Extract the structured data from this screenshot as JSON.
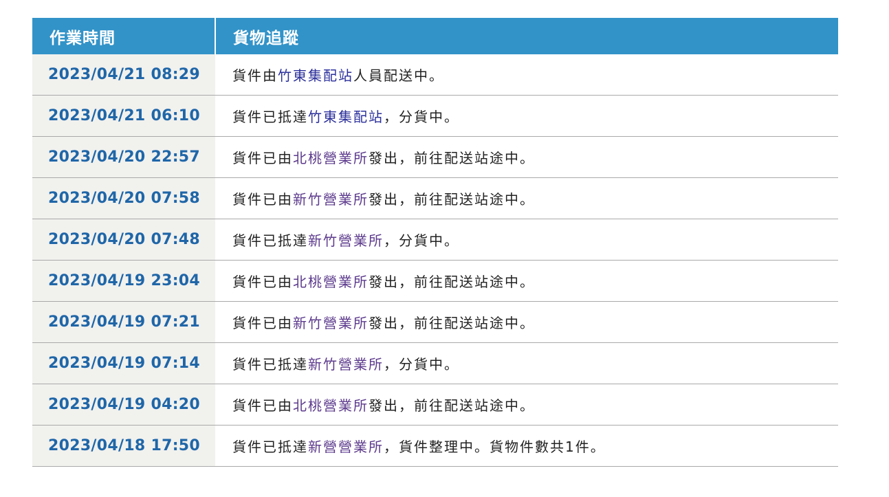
{
  "header": {
    "time_label": "作業時間",
    "status_label": "貨物追蹤"
  },
  "rows": [
    {
      "time": "2023/04/21 08:29",
      "pre": "貨件由",
      "place": "竹東集配站",
      "post": "人員配送中。"
    },
    {
      "time": "2023/04/21 06:10",
      "pre": "貨件已抵達",
      "place": "竹東集配站",
      "post": "，分貨中。"
    },
    {
      "time": "2023/04/20 22:57",
      "pre": "貨件已由",
      "place": "北桃營業所",
      "post": "發出，前往配送站途中。"
    },
    {
      "time": "2023/04/20 07:58",
      "pre": "貨件已由",
      "place": "新竹營業所",
      "post": "發出，前往配送站途中。"
    },
    {
      "time": "2023/04/20 07:48",
      "pre": "貨件已抵達",
      "place": "新竹營業所",
      "post": "，分貨中。"
    },
    {
      "time": "2023/04/19 23:04",
      "pre": "貨件已由",
      "place": "北桃營業所",
      "post": "發出，前往配送站途中。"
    },
    {
      "time": "2023/04/19 07:21",
      "pre": "貨件已由",
      "place": "新竹營業所",
      "post": "發出，前往配送站途中。"
    },
    {
      "time": "2023/04/19 07:14",
      "pre": "貨件已抵達",
      "place": "新竹營業所",
      "post": "，分貨中。"
    },
    {
      "time": "2023/04/19 04:20",
      "pre": "貨件已由",
      "place": "北桃營業所",
      "post": "發出，前往配送站途中。"
    },
    {
      "time": "2023/04/18 17:50",
      "pre": "貨件已抵達",
      "place": "新營營業所",
      "post": "，貨件整理中。貨物件數共1件。"
    }
  ],
  "colors": {
    "header_bg": "#3293c8",
    "time_text": "#1f66a8",
    "time_cell_bg": "#f1f1ee",
    "station_link": "#2b2f9a",
    "office_link": "#5c3a8c"
  }
}
